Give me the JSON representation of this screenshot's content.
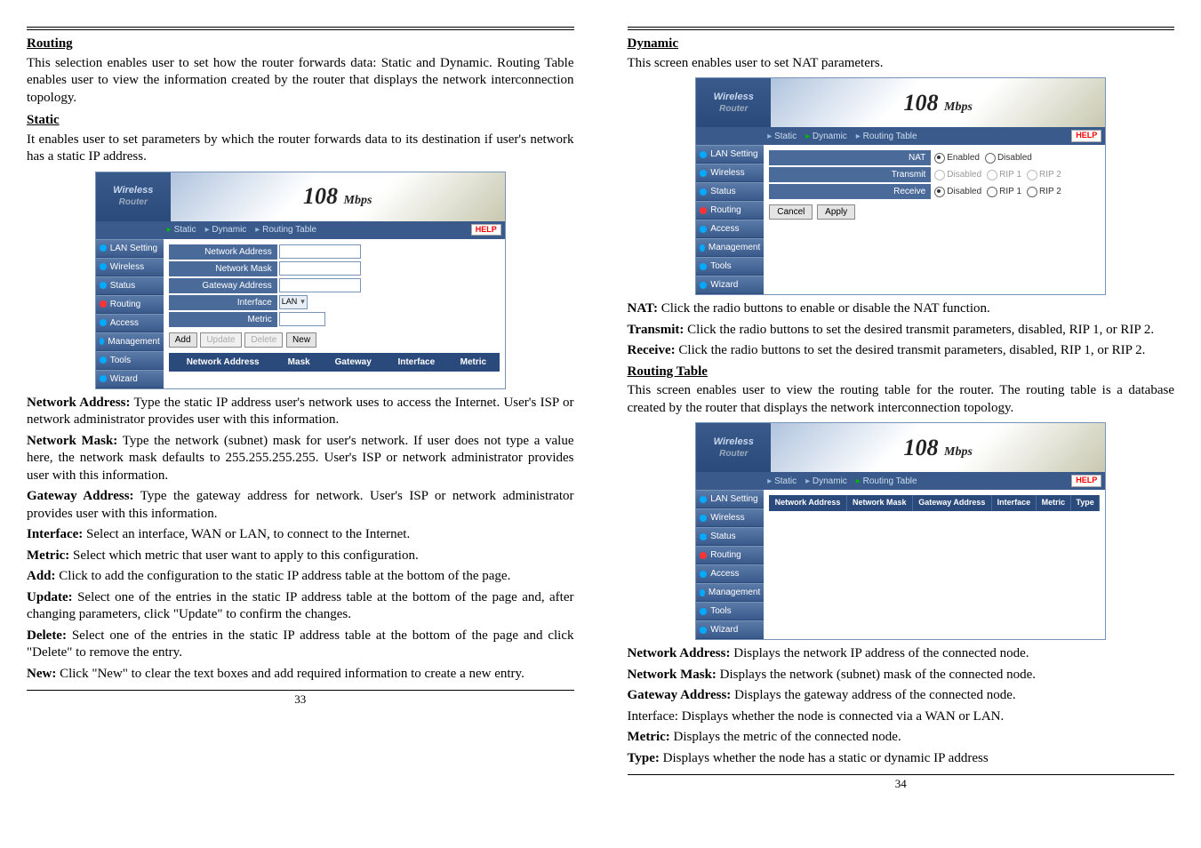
{
  "page_left": {
    "number": "33",
    "routing": {
      "title": "Routing",
      "para": "This selection enables user to set how the router forwards data: Static and Dynamic. Routing Table enables user to view the information created by the router that displays the network interconnection topology."
    },
    "static": {
      "title": "Static",
      "para": "It enables user to set parameters by which the router forwards data to its destination if user's network has a static IP address."
    },
    "defs": {
      "na": {
        "k": "Network Address:",
        "v": "Type the static IP address user's network uses to access the Internet. User's ISP or network administrator provides user with this information."
      },
      "nm": {
        "k": "Network Mask:",
        "v": "Type the network (subnet) mask for user's network. If user does not type a value here, the network mask defaults to 255.255.255.255. User's ISP or network administrator provides user with this information."
      },
      "ga": {
        "k": "Gateway Address:",
        "v": "Type the gateway address for network. User's ISP or network administrator provides user with this information."
      },
      "if": {
        "k": "Interface:",
        "v": "Select an interface, WAN or LAN, to connect to the Internet."
      },
      "me": {
        "k": "Metric:",
        "v": "Select which metric that user want to apply to this configuration."
      },
      "add": {
        "k": "Add:",
        "v": "Click to add the configuration to the static IP address table at the bottom of the page."
      },
      "upd": {
        "k": "Update:",
        "v": "Select one of the entries in the static IP address table at the bottom of the page and, after changing parameters, click \"Update\" to confirm the changes."
      },
      "del": {
        "k": "Delete:",
        "v": "Select one of the entries in the static IP address table at the bottom of the page and click \"Delete\" to remove the entry."
      },
      "new": {
        "k": "New:",
        "v": "Click \"New\" to clear the text boxes and add required information to create a new entry."
      }
    }
  },
  "page_right": {
    "number": "34",
    "dynamic": {
      "title": "Dynamic",
      "para": "This screen enables user to set NAT parameters."
    },
    "defs": {
      "nat": {
        "k": "NAT:",
        "v": "Click the radio buttons to enable or disable the NAT function."
      },
      "tx": {
        "k": "Transmit:",
        "v": "Click the radio buttons to set the desired transmit parameters, disabled, RIP 1, or RIP 2."
      },
      "rx": {
        "k": "Receive:",
        "v": "Click the radio buttons to set the desired transmit parameters, disabled, RIP 1, or RIP 2."
      }
    },
    "rt": {
      "title": "Routing Table",
      "para": "This screen enables user to view the routing table for the router. The routing table is a database created by the router that displays the network interconnection topology."
    },
    "rtdefs": {
      "na": {
        "k": "Network Address:",
        "v": "Displays the network IP address of the connected node."
      },
      "nm": {
        "k": "Network Mask:",
        "v": "Displays the network (subnet) mask of the connected node."
      },
      "ga": {
        "k": "Gateway Address:",
        "v": "Displays the gateway address of the connected node."
      },
      "if": {
        "k": "",
        "v": "Interface: Displays whether the node is connected via a WAN or LAN."
      },
      "me": {
        "k": "Metric:",
        "v": "Displays the metric of the connected node."
      },
      "ty": {
        "k": "Type:",
        "v": "Displays whether the node has a static or dynamic IP address"
      }
    }
  },
  "router": {
    "brand1": "Wireless",
    "brand2": "Router",
    "banner": "108",
    "banner_unit": "Mbps",
    "tabs": {
      "static": "Static",
      "dynamic": "Dynamic",
      "rt": "Routing Table"
    },
    "help": "HELP",
    "side": [
      "LAN Setting",
      "Wireless",
      "Status",
      "Routing",
      "Access",
      "Management",
      "Tools",
      "Wizard"
    ]
  },
  "static_form": {
    "labels": {
      "na": "Network Address",
      "nm": "Network Mask",
      "ga": "Gateway Address",
      "if": "Interface",
      "me": "Metric"
    },
    "interface": "LAN",
    "buttons": {
      "add": "Add",
      "update": "Update",
      "delete": "Delete",
      "new": "New"
    },
    "cols": [
      "Network Address",
      "Mask",
      "Gateway",
      "Interface",
      "Metric"
    ]
  },
  "dynamic_form": {
    "labels": {
      "nat": "NAT",
      "tx": "Transmit",
      "rx": "Receive"
    },
    "opts": {
      "enabled": "Enabled",
      "disabled": "Disabled",
      "rip1": "RIP 1",
      "rip2": "RIP 2"
    },
    "buttons": {
      "cancel": "Cancel",
      "apply": "Apply"
    }
  },
  "rt_cols": [
    "Network Address",
    "Network Mask",
    "Gateway Address",
    "Interface",
    "Metric",
    "Type"
  ]
}
